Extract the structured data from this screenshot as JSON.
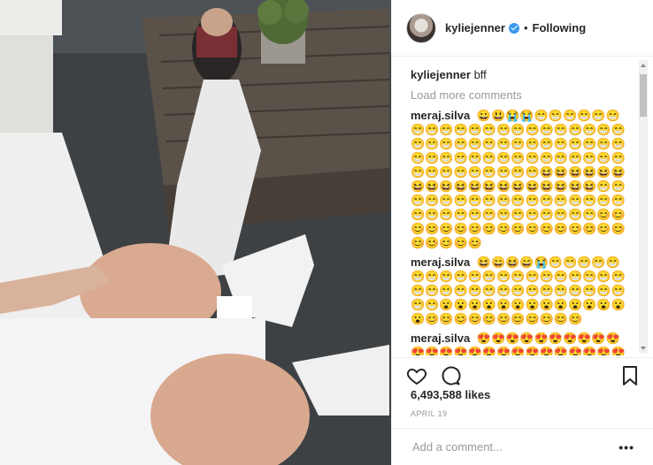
{
  "post": {
    "username": "kyliejenner",
    "follow_status": "Following",
    "caption_user": "kyliejenner",
    "caption_text": "bff",
    "load_more": "Load more comments",
    "likes": "6,493,588 likes",
    "date": "APRIL 19",
    "add_comment_placeholder": "Add a comment...",
    "more_label": "•••"
  },
  "comments": [
    {
      "user": "meraj.silva",
      "text": "😀😃😭😭😁😁😁😁😁😁😁😁😁😁😁😁😁😁😁😁😁😁😁😁😁😁😁😁😁😁😁😁😁😁😁😁😁😁😁😁😁😁😁😁😁😁😁😁😁😁😁😁😁😁😁😁😁😁😁😁😁😁😁😁😆😆😆😆😆😆😆😆😆😆😆😆😆😆😆😆😆😆😆😁😁😁😁😁😁😁😁😁😁😁😁😁😁😁😁😁😁😁😁😁😁😁😁😁😁😁😁😁😁😊😊😊😊😊😊😊😊😊😊😊😊😊😊😊😊😊😊😊😊😊😊"
    },
    {
      "user": "meraj.silva",
      "text": "😆😄😆😄😭😁😁😁😁😁😁😁😁😁😁😁😁😁😁😁😁😁😁😁😁😁😁😁😁😁😁😁😁😁😁😁😁😁😁😁😁😁😮😮😮😮😮😮😮😮😮😮😮😮😮😮😊😊😊😊😊😊😊😊😊😊😊"
    },
    {
      "user": "meraj.silva",
      "text": "😍😍😍😍😍😍😍😍😍😍😍😍😍😍😍😍😍😍😍😍😍😍😍😍😍"
    }
  ]
}
